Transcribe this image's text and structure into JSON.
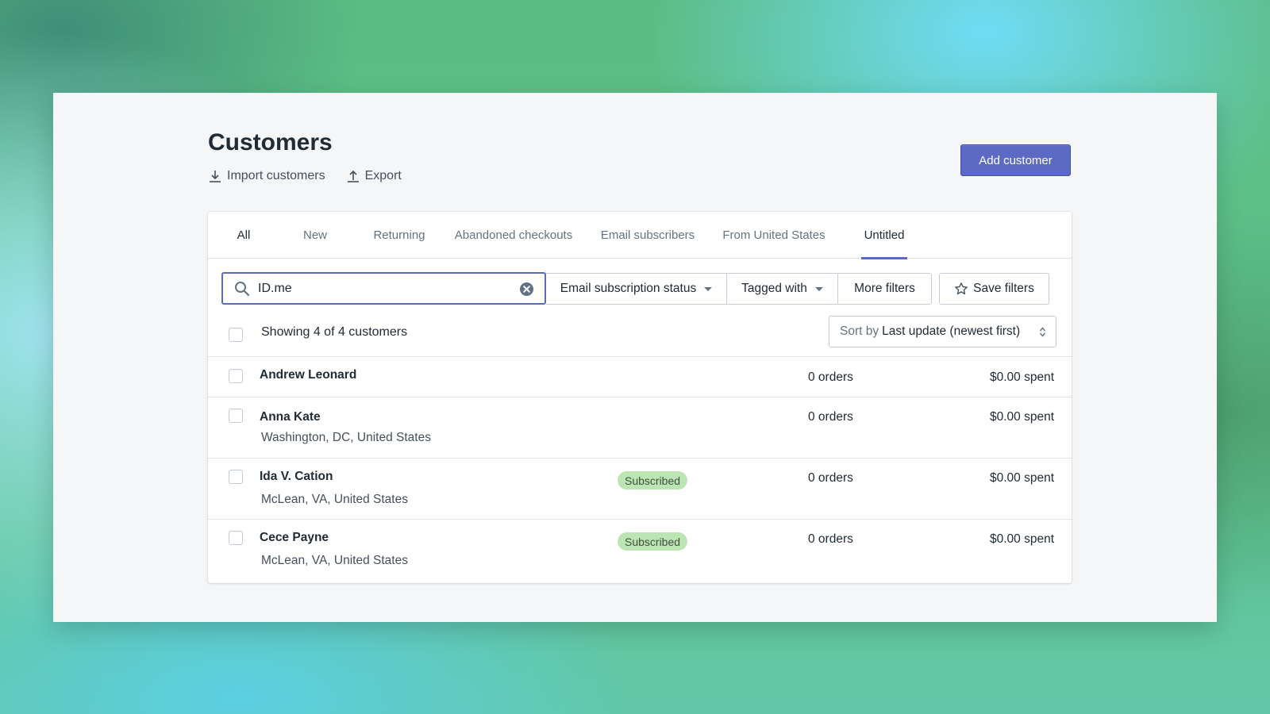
{
  "page": {
    "title": "Customers",
    "import_label": "Import customers",
    "export_label": "Export",
    "add_customer_label": "Add customer"
  },
  "tabs": [
    {
      "label": "All"
    },
    {
      "label": "New"
    },
    {
      "label": "Returning"
    },
    {
      "label": "Abandoned checkouts"
    },
    {
      "label": "Email subscribers"
    },
    {
      "label": "From United States"
    },
    {
      "label": "Untitled"
    }
  ],
  "search": {
    "value": "ID.me",
    "icon": "search-icon",
    "clear_icon": "clear-circle-icon"
  },
  "filters": {
    "email_status_label": "Email subscription status",
    "tagged_label": "Tagged with",
    "more_label": "More filters",
    "save_label": "Save filters"
  },
  "list": {
    "showing_text": "Showing 4 of 4 customers",
    "sort_prefix": "Sort by",
    "sort_value": "Last update (newest first)"
  },
  "customers": [
    {
      "name": "Andrew Leonard",
      "location": "",
      "badge": "",
      "orders": "0 orders",
      "spent": "$0.00 spent"
    },
    {
      "name": "Anna Kate",
      "location": "Washington, DC, United States",
      "badge": "",
      "orders": "0 orders",
      "spent": "$0.00 spent"
    },
    {
      "name": "Ida V. Cation",
      "location": "McLean, VA, United States",
      "badge": "Subscribed",
      "orders": "0 orders",
      "spent": "$0.00 spent"
    },
    {
      "name": "Cece Payne",
      "location": "McLean, VA, United States",
      "badge": "Subscribed",
      "orders": "0 orders",
      "spent": "$0.00 spent"
    }
  ],
  "colors": {
    "accent": "#5c6ac4",
    "badge_bg": "#bbe5b3"
  }
}
